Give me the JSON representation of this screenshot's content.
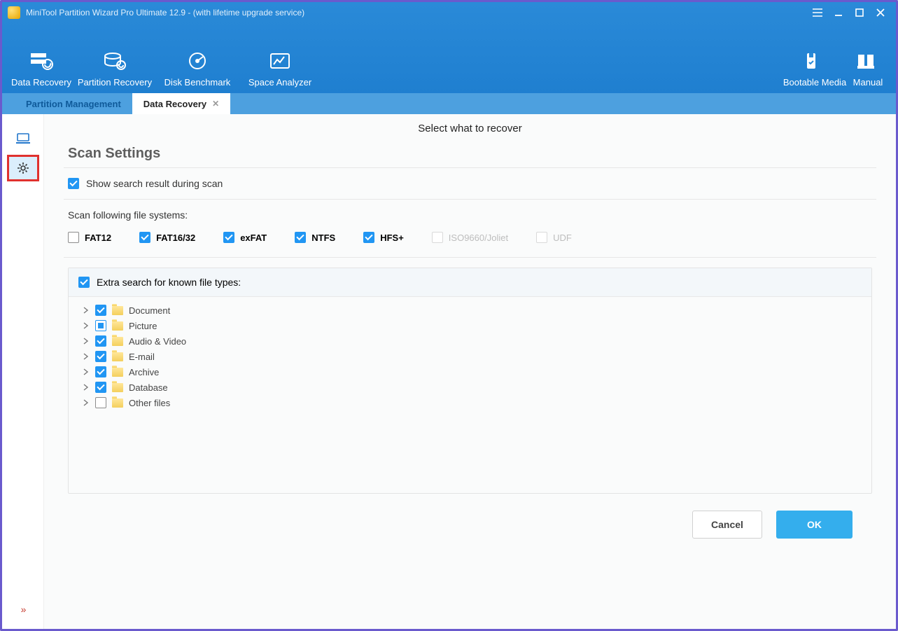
{
  "titlebar": {
    "title": "MiniTool Partition Wizard Pro Ultimate 12.9 - (with lifetime upgrade service)"
  },
  "toolbar": {
    "items": [
      {
        "label": "Data Recovery"
      },
      {
        "label": "Partition Recovery"
      },
      {
        "label": "Disk Benchmark"
      },
      {
        "label": "Space Analyzer"
      }
    ],
    "right_items": [
      {
        "label": "Bootable Media"
      },
      {
        "label": "Manual"
      }
    ]
  },
  "tabs": {
    "inactive": "Partition Management",
    "active": "Data Recovery"
  },
  "page": {
    "header": "Select what to recover",
    "panel_title": "Scan Settings",
    "show_search_label": "Show search result during scan",
    "fs_section_label": "Scan following file systems:",
    "filesystems": [
      {
        "label": "FAT12",
        "checked": false,
        "disabled": false
      },
      {
        "label": "FAT16/32",
        "checked": true,
        "disabled": false
      },
      {
        "label": "exFAT",
        "checked": true,
        "disabled": false
      },
      {
        "label": "NTFS",
        "checked": true,
        "disabled": false
      },
      {
        "label": "HFS+",
        "checked": true,
        "disabled": false
      },
      {
        "label": "ISO9660/Joliet",
        "checked": false,
        "disabled": true
      },
      {
        "label": "UDF",
        "checked": false,
        "disabled": true
      }
    ],
    "extra_search_label": "Extra search for known file types:",
    "tree": [
      {
        "label": "Document",
        "state": "checked"
      },
      {
        "label": "Picture",
        "state": "partial"
      },
      {
        "label": "Audio & Video",
        "state": "checked"
      },
      {
        "label": "E-mail",
        "state": "checked"
      },
      {
        "label": "Archive",
        "state": "checked"
      },
      {
        "label": "Database",
        "state": "checked"
      },
      {
        "label": "Other files",
        "state": "unchecked"
      }
    ],
    "buttons": {
      "cancel": "Cancel",
      "ok": "OK"
    }
  }
}
